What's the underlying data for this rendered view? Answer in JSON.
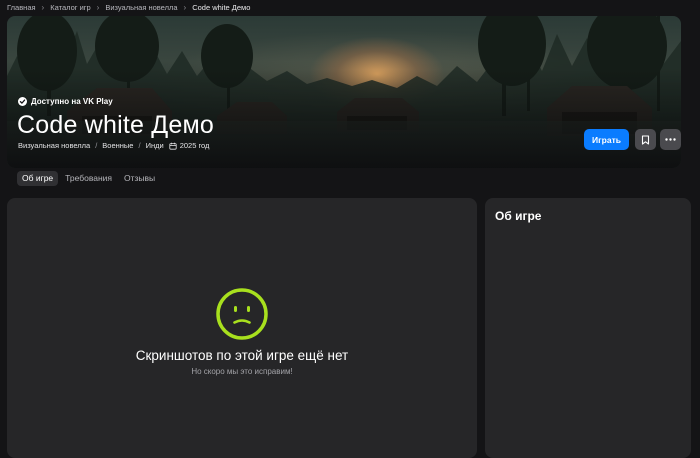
{
  "breadcrumb": {
    "items": [
      "Главная",
      "Каталог игр",
      "Визуальная новелла"
    ],
    "current": "Code white Демо"
  },
  "hero": {
    "availability": "Доступно на VK Play",
    "title": "Code white Демо",
    "tags": [
      "Визуальная новелла",
      "Военные",
      "Инди"
    ],
    "year": "2025 год",
    "play_label": "Играть",
    "bookmark_icon": "bookmark-icon",
    "more_icon": "more-dots-icon"
  },
  "tabs": [
    {
      "label": "Об игре",
      "active": true
    },
    {
      "label": "Требования",
      "active": false
    },
    {
      "label": "Отзывы",
      "active": false
    }
  ],
  "screenshots": {
    "empty_title": "Скриншотов по этой игре ещё нет",
    "empty_subtitle": "Но скоро мы это исправим!",
    "icon": "sad-face-icon"
  },
  "sidebar": {
    "title": "Об игре"
  },
  "colors": {
    "accent": "#0a7cff",
    "sad_face": "#a8e01e",
    "background": "#141416",
    "panel": "#262628"
  }
}
